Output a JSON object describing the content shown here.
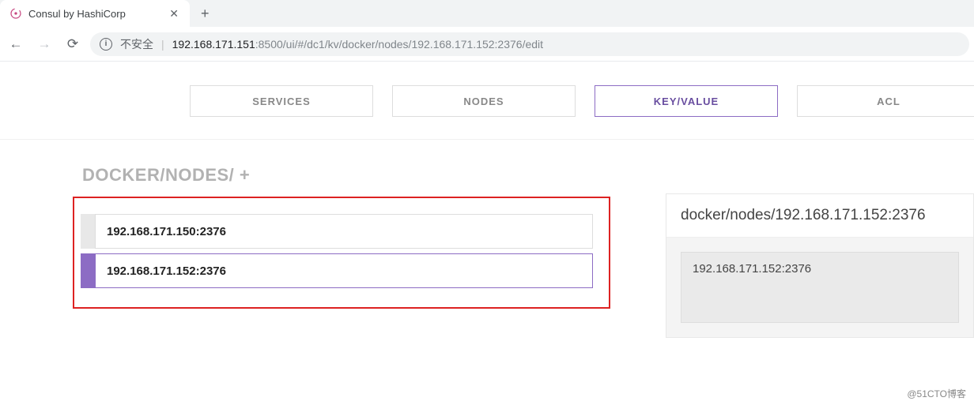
{
  "browser": {
    "tab_title": "Consul by HashiCorp",
    "security_label": "不安全",
    "url_host": "192.168.171.151",
    "url_port": ":8500",
    "url_path": "/ui/#/dc1/kv/docker/nodes/192.168.171.152:2376/edit"
  },
  "nav": {
    "services": "SERVICES",
    "nodes": "NODES",
    "keyvalue": "KEY/VALUE",
    "acl": "ACL"
  },
  "kv": {
    "breadcrumb": "DOCKER/NODES/ +",
    "items": [
      {
        "label": "192.168.171.150:2376",
        "selected": false
      },
      {
        "label": "192.168.171.152:2376",
        "selected": true
      }
    ]
  },
  "editor": {
    "key_path": "docker/nodes/192.168.171.152:2376",
    "value": "192.168.171.152:2376"
  },
  "watermark": "@51CTO博客"
}
